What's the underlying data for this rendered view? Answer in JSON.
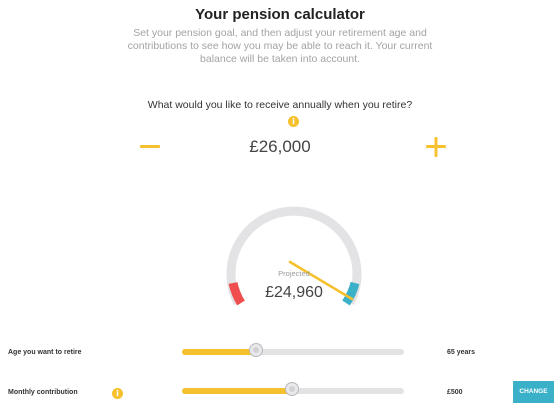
{
  "header": {
    "title": "Your pension calculator",
    "subtitle": "Set your pension goal, and then adjust your retirement age and contributions to see how you may be able to reach it. Your current balance will be taken into account."
  },
  "goal": {
    "question": "What would you like to receive annually when you retire?",
    "value": "£26,000",
    "decrease_icon": "minus-icon",
    "increase_icon": "plus-icon",
    "info_icon": "info-icon"
  },
  "gauge": {
    "label": "Projected",
    "value": "£24,960",
    "fraction_of_goal": 0.96
  },
  "sliders": {
    "retire_age": {
      "label": "Age you want to retire",
      "value": "65 years",
      "fill_fraction": 0.34
    },
    "contribution": {
      "label": "Monthly contribution",
      "value": "£500",
      "fill_fraction": 0.5,
      "info_icon": "info-icon"
    }
  },
  "actions": {
    "change_label": "CHANGE"
  },
  "colors": {
    "accent": "#f5c12e",
    "teal": "#3ab1c8",
    "red": "#f04e4e",
    "track": "#e3e3e6"
  }
}
